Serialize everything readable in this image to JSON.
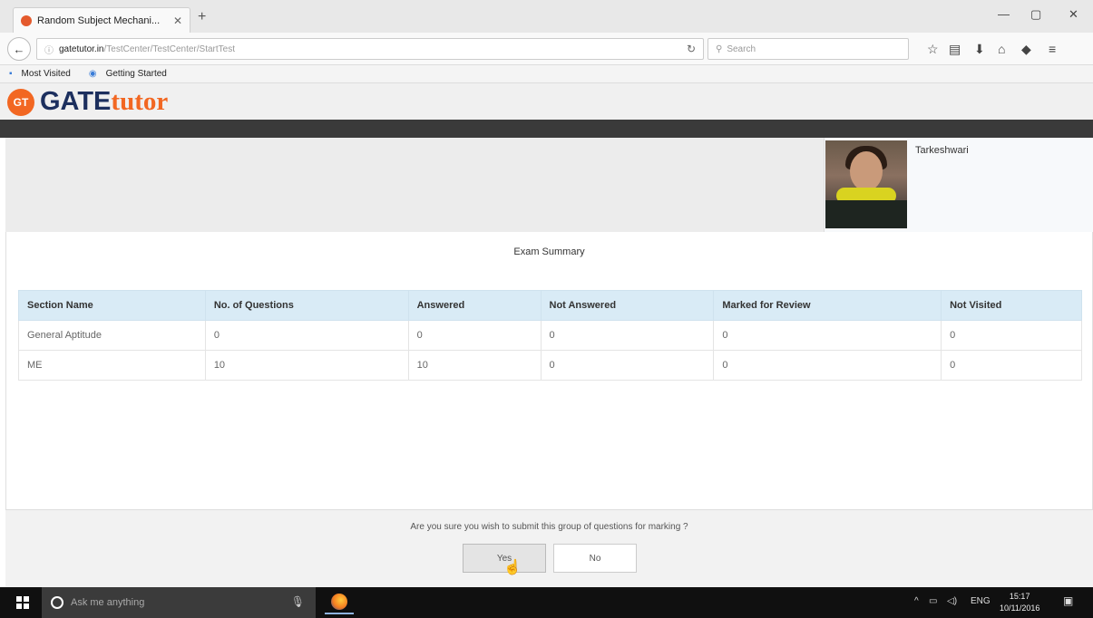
{
  "browser": {
    "tab_title": "Random Subject Mechani...",
    "tab_close": "✕",
    "new_tab": "+",
    "url_domain": "gatetutor.in",
    "url_path": "/TestCenter/TestCenter/StartTest",
    "search_placeholder": "Search",
    "bookmarks": [
      "Most Visited",
      "Getting Started"
    ]
  },
  "site": {
    "logo_badge": "GT",
    "logo_gate": "GATE",
    "logo_tutor": "tutor"
  },
  "user": {
    "name": "Tarkeshwari"
  },
  "summary": {
    "title": "Exam Summary",
    "columns": [
      "Section Name",
      "No. of Questions",
      "Answered",
      "Not Answered",
      "Marked for Review",
      "Not Visited"
    ],
    "rows": [
      [
        "General Aptitude",
        "0",
        "0",
        "0",
        "0",
        "0"
      ],
      [
        "ME",
        "10",
        "10",
        "0",
        "0",
        "0"
      ]
    ]
  },
  "dialog": {
    "question": "Are you sure you wish to submit this group of questions for marking ?",
    "yes_label": "Yes",
    "no_label": "No"
  },
  "taskbar": {
    "search_placeholder": "Ask me anything",
    "language": "ENG",
    "time": "15:17",
    "date": "10/11/2016"
  },
  "colors": {
    "accent_orange": "#f26722",
    "logo_navy": "#1c2f5e",
    "table_header": "#d9ebf6"
  }
}
